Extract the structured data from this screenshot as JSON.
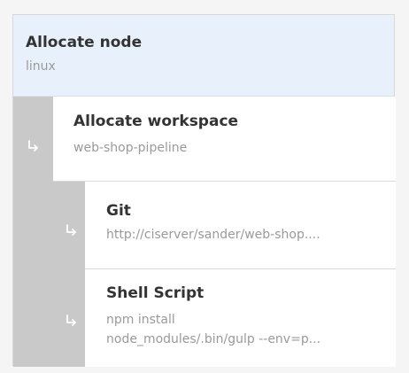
{
  "pipeline": {
    "nodes": [
      {
        "title": "Allocate node",
        "subtitle": "linux"
      },
      {
        "title": "Allocate workspace",
        "subtitle": "web-shop-pipeline"
      },
      {
        "title": "Git",
        "subtitle": "http://ciserver/sander/web-shop...."
      },
      {
        "title": "Shell Script",
        "subtitle_line1": "npm install",
        "subtitle_line2": "node_modules/.bin/gulp --env=p..."
      }
    ]
  },
  "icons": {
    "nested_arrow": "subdirectory-arrow-right-icon"
  },
  "colors": {
    "background": "#f5f5f5",
    "highlight": "#e8f1fb",
    "rail": "#c9c9c9",
    "title": "#333333",
    "subtitle": "#9a9a9a"
  }
}
